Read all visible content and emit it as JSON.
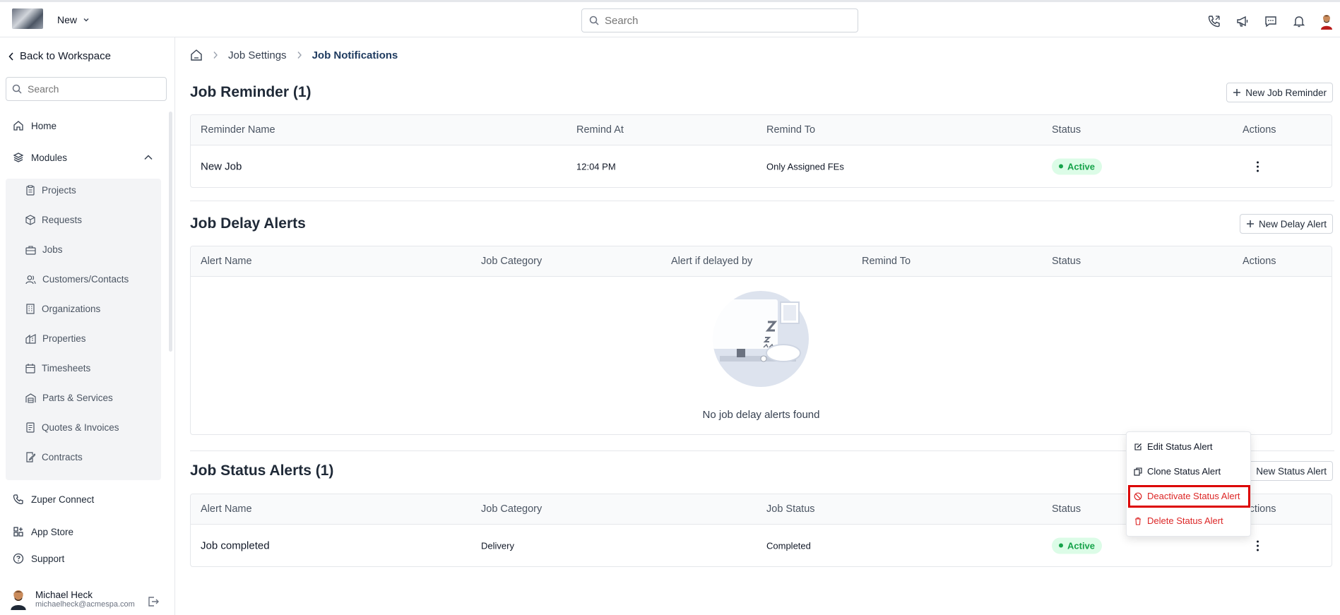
{
  "topbar": {
    "new_label": "New",
    "search_placeholder": "Search"
  },
  "sidebar": {
    "back_label": "Back to Workspace",
    "search_placeholder": "Search",
    "home": "Home",
    "modules": "Modules",
    "sub_items": [
      "Projects",
      "Requests",
      "Jobs",
      "Customers/Contacts",
      "Organizations",
      "Properties",
      "Timesheets",
      "Parts & Services",
      "Quotes & Invoices",
      "Contracts"
    ],
    "bottom_items": [
      "Zuper Connect",
      "App Store",
      "Support"
    ],
    "user": {
      "name": "Michael Heck",
      "email": "michaelheck@acmespa.com"
    }
  },
  "breadcrumb": {
    "parent": "Job Settings",
    "current": "Job Notifications"
  },
  "reminders": {
    "title": "Job Reminder (1)",
    "button": "New Job Reminder",
    "columns": [
      "Reminder Name",
      "Remind At",
      "Remind To",
      "Status",
      "Actions"
    ],
    "rows": [
      {
        "name": "New Job",
        "remind_at": "12:04 PM",
        "remind_to": "Only Assigned FEs",
        "status": "Active"
      }
    ]
  },
  "delay": {
    "title": "Job Delay Alerts",
    "button": "New Delay Alert",
    "columns": [
      "Alert Name",
      "Job Category",
      "Alert if delayed by",
      "Remind To",
      "Status",
      "Actions"
    ],
    "empty_text": "No job delay alerts found"
  },
  "status_alerts": {
    "title": "Job Status Alerts (1)",
    "button": "New Status Alert",
    "columns": [
      "Alert Name",
      "Job Category",
      "Job Status",
      "Status",
      "Actions"
    ],
    "rows": [
      {
        "name": "Job completed",
        "category": "Delivery",
        "job_status": "Completed",
        "status": "Active"
      }
    ]
  },
  "context_menu": {
    "edit": "Edit Status Alert",
    "clone": "Clone Status Alert",
    "deactivate": "Deactivate Status Alert",
    "delete": "Delete Status Alert"
  },
  "colors": {
    "active_green": "#16a34a",
    "danger_red": "#dc2626",
    "highlight": "#dc0000"
  }
}
